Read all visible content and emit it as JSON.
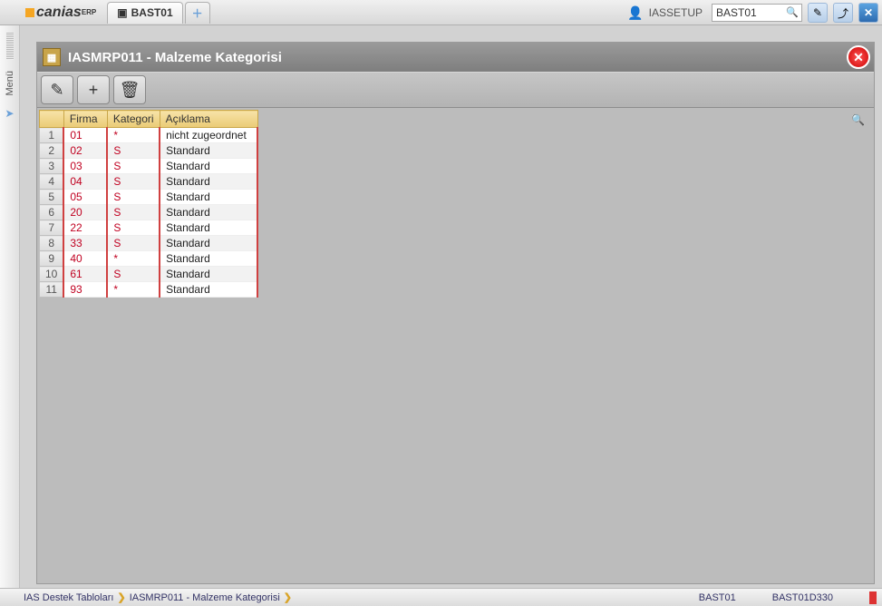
{
  "app": {
    "name": "canias",
    "suffix": "ERP"
  },
  "tabs": {
    "active": "BAST01"
  },
  "user": {
    "name": "IASSETUP"
  },
  "search": {
    "value": "BAST01"
  },
  "sidebar": {
    "label": "Menü"
  },
  "panel": {
    "title": "IASMRP011 - Malzeme Kategorisi",
    "toolbar": {
      "edit": "✎",
      "add": "+",
      "delete": "🗑"
    }
  },
  "grid": {
    "headers": {
      "firma": "Firma",
      "kategori": "Kategori",
      "aciklama": "Açıklama"
    },
    "rows": [
      {
        "n": "1",
        "firma": "01",
        "kategori": "*",
        "aciklama": "nicht zugeordnet"
      },
      {
        "n": "2",
        "firma": "02",
        "kategori": "S",
        "aciklama": "Standard"
      },
      {
        "n": "3",
        "firma": "03",
        "kategori": "S",
        "aciklama": "Standard"
      },
      {
        "n": "4",
        "firma": "04",
        "kategori": "S",
        "aciklama": "Standard"
      },
      {
        "n": "5",
        "firma": "05",
        "kategori": "S",
        "aciklama": "Standard"
      },
      {
        "n": "6",
        "firma": "20",
        "kategori": "S",
        "aciklama": "Standard"
      },
      {
        "n": "7",
        "firma": "22",
        "kategori": "S",
        "aciklama": "Standard"
      },
      {
        "n": "8",
        "firma": "33",
        "kategori": "S",
        "aciklama": "Standard"
      },
      {
        "n": "9",
        "firma": "40",
        "kategori": "*",
        "aciklama": "Standard"
      },
      {
        "n": "10",
        "firma": "61",
        "kategori": "S",
        "aciklama": "Standard"
      },
      {
        "n": "11",
        "firma": "93",
        "kategori": "*",
        "aciklama": "Standard"
      }
    ]
  },
  "status": {
    "crumb1": "IAS Destek Tabloları",
    "crumb2": "IASMRP011 - Malzeme Kategorisi",
    "code1": "BAST01",
    "code2": "BAST01D330"
  }
}
